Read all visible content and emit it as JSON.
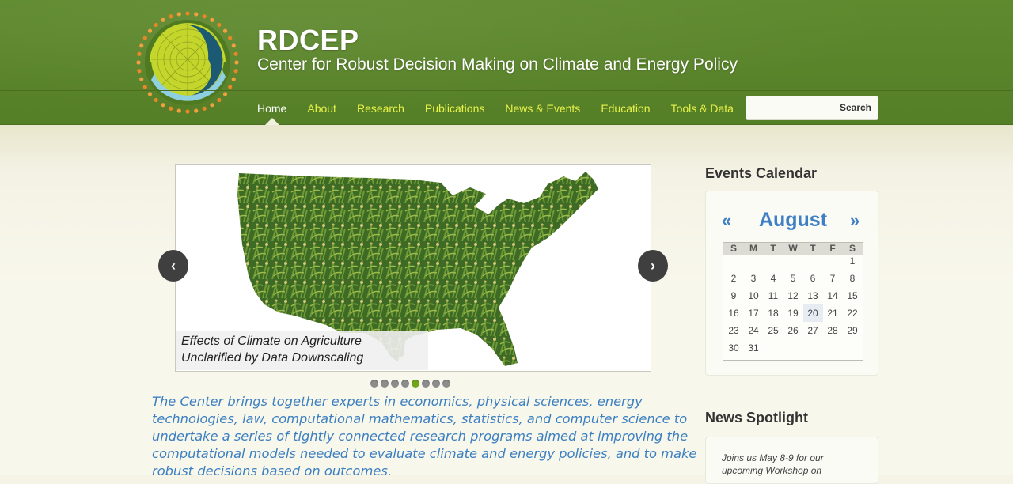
{
  "site": {
    "title": "RDCEP",
    "tagline": "Center for Robust Decision Making on Climate and Energy Policy"
  },
  "nav": {
    "items": [
      {
        "label": "Home",
        "active": true
      },
      {
        "label": "About"
      },
      {
        "label": "Research"
      },
      {
        "label": "Publications"
      },
      {
        "label": "News & Events"
      },
      {
        "label": "Education"
      },
      {
        "label": "Tools & Data"
      }
    ]
  },
  "search": {
    "placeholder": "",
    "button_label": "Search"
  },
  "slider": {
    "caption_line1": "Effects of Climate on Agriculture",
    "caption_line2": "Unclarified by Data Downscaling",
    "prev_icon": "chevron-left-icon",
    "next_icon": "chevron-right-icon",
    "prev_glyph": "‹",
    "next_glyph": "›",
    "dot_count": 8,
    "active_dot": 5
  },
  "intro": "The Center brings together experts in economics, physical sciences, energy technologies, law, computational mathematics, statistics, and computer science to undertake a series of tightly connected research programs aimed at improving the computational models needed to evaluate climate and energy policies, and to make robust decisions based on outcomes.",
  "events": {
    "heading": "Events Calendar",
    "prev": "«",
    "next": "»",
    "month": "August",
    "weekdays": [
      "S",
      "M",
      "T",
      "W",
      "T",
      "F",
      "S"
    ],
    "first_weekday": 6,
    "days_in_month": 31,
    "highlighted_day": 20
  },
  "news": {
    "heading": "News Spotlight",
    "text": "Joins us May 8-9 for our upcoming Workshop on"
  },
  "colors": {
    "header_green": "#5a8429",
    "nav_link": "#e8f24a",
    "accent_blue": "#3f7fc4"
  }
}
